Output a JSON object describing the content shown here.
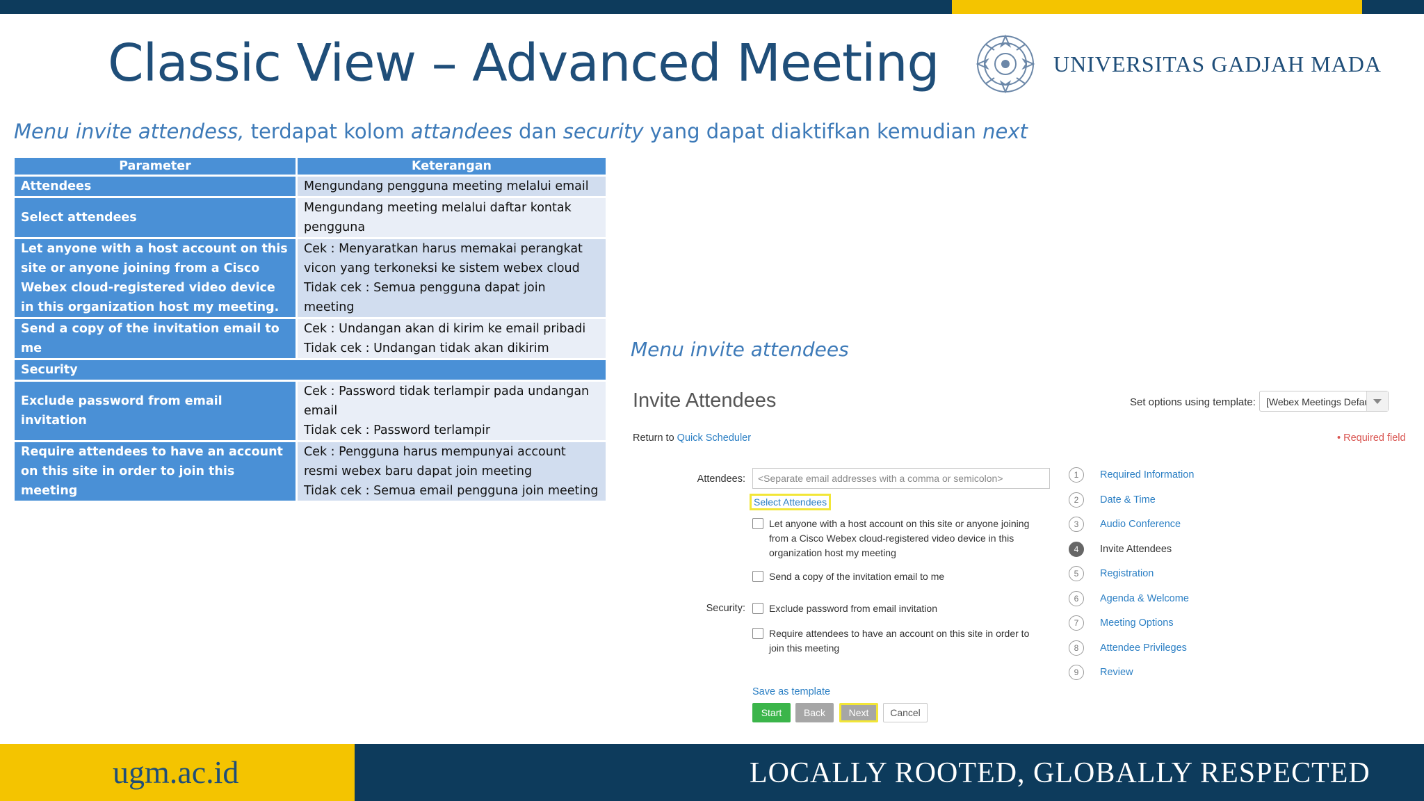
{
  "slide": {
    "title": "Classic View – Advanced Meeting",
    "university": "UNIVERSITAS GADJAH MADA",
    "subtitle": {
      "p1": "Menu invite attendess,",
      "p2": " terdapat kolom ",
      "p3": "attandees",
      "p4": " dan ",
      "p5": "security",
      "p6": " yang dapat diaktifkan kemudian ",
      "p7": "next"
    },
    "menu_label": "Menu invite attendees",
    "footer_site": "ugm.ac.id",
    "footer_slogan": "LOCALLY ROOTED, GLOBALLY RESPECTED"
  },
  "table": {
    "headers": [
      "Parameter",
      "Keterangan"
    ],
    "rows": [
      {
        "param": "Attendees",
        "lines": [
          "Mengundang pengguna meeting melalui email"
        ]
      },
      {
        "param": "Select attendees",
        "lines": [
          "Mengundang meeting melalui daftar kontak pengguna"
        ]
      },
      {
        "param": "Let anyone with a host account on this site or anyone joining from a Cisco Webex cloud-registered video device in this organization host my meeting.",
        "lines": [
          "Cek : Menyaratkan harus memakai perangkat vicon yang terkoneksi ke sistem webex cloud",
          "Tidak cek : Semua pengguna dapat join meeting"
        ]
      },
      {
        "param": "Send a copy of the invitation email to me",
        "lines": [
          "Cek : Undangan akan di kirim ke email pribadi",
          "Tidak cek : Undangan tidak akan dikirim"
        ]
      },
      {
        "section": "Security"
      },
      {
        "param": "Exclude password from email invitation",
        "lines": [
          "Cek : Password  tidak terlampir pada undangan email",
          "Tidak cek : Password terlampir"
        ]
      },
      {
        "param": "Require attendees to have an account on this site in order to join this meeting",
        "lines": [
          "Cek : Pengguna harus mempunyai account resmi webex baru dapat join meeting",
          "Tidak cek : Semua email pengguna join meeting"
        ]
      }
    ]
  },
  "webex": {
    "title": "Invite Attendees",
    "template_label": "Set options using template:",
    "template_value": "[Webex Meetings Default]",
    "return_text": "Return to ",
    "return_link": "Quick Scheduler",
    "required_field": "• Required field",
    "attendees_label": "Attendees:",
    "attendees_placeholder": "<Separate email addresses with a comma or semicolon>",
    "select_attendees": "Select Attendees",
    "checkbox_host": "Let anyone with a host account on this site or anyone joining from a Cisco Webex cloud-registered video device in this organization host my meeting",
    "checkbox_copy": "Send a copy of the invitation email to me",
    "security_label": "Security:",
    "checkbox_exclude": "Exclude password from email invitation",
    "checkbox_require": "Require attendees to have an account on this site in order to join this meeting",
    "save_template": "Save as template",
    "buttons": {
      "start": "Start",
      "back": "Back",
      "next": "Next",
      "cancel": "Cancel"
    },
    "steps": [
      {
        "num": "1",
        "label": "Required Information"
      },
      {
        "num": "2",
        "label": "Date & Time"
      },
      {
        "num": "3",
        "label": "Audio Conference"
      },
      {
        "num": "4",
        "label": "Invite Attendees",
        "active": true
      },
      {
        "num": "5",
        "label": "Registration"
      },
      {
        "num": "6",
        "label": "Agenda & Welcome"
      },
      {
        "num": "7",
        "label": "Meeting Options"
      },
      {
        "num": "8",
        "label": "Attendee Privileges"
      },
      {
        "num": "9",
        "label": "Review"
      }
    ]
  }
}
